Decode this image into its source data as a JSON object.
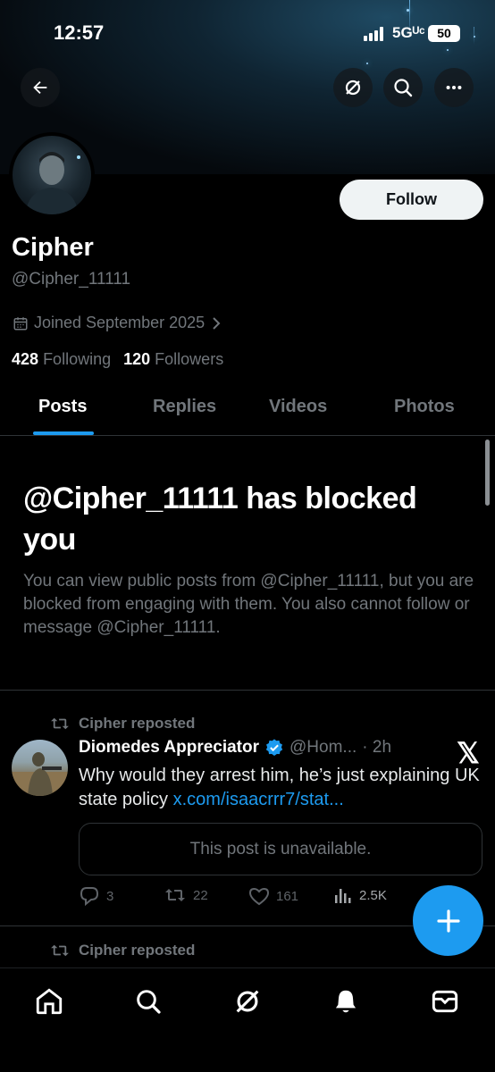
{
  "status_bar": {
    "time": "12:57",
    "network": "5Gᵁᶜ",
    "battery": "50"
  },
  "profile": {
    "name": "Cipher",
    "handle": "@Cipher_11111",
    "joined": "Joined September 2025",
    "following_count": "428",
    "following_label": "Following",
    "followers_count": "120",
    "followers_label": "Followers",
    "follow_button": "Follow"
  },
  "tabs": [
    {
      "label": "Posts",
      "active": true
    },
    {
      "label": "Replies",
      "active": false
    },
    {
      "label": "Videos",
      "active": false
    },
    {
      "label": "Photos",
      "active": false
    }
  ],
  "blocked_notice": {
    "title": "@Cipher_11111 has blocked you",
    "text": "You can view public posts from @Cipher_11111, but you are blocked from engaging with them. You also cannot follow or message @Cipher_11111."
  },
  "posts": [
    {
      "repost_label": "Cipher reposted",
      "author": "Diomedes Appreciator",
      "verified": true,
      "handle": "@Hom...",
      "time": "· 2h",
      "text": "Why would they arrest him, he’s just explaining UK state policy ",
      "link": "x.com/isaacrrr7/stat...",
      "quoted": "This post is unavailable.",
      "replies": "3",
      "reposts": "22",
      "likes": "161",
      "views": "2.5K",
      "logo": "𝕏"
    },
    {
      "repost_label": "Cipher reposted"
    }
  ],
  "colors": {
    "accent": "#1d9bf0",
    "background": "#000000",
    "muted": "#71767b",
    "divider": "#2f3336"
  },
  "icons": [
    "back-arrow-icon",
    "grok-icon",
    "search-icon",
    "more-icon",
    "calendar-icon",
    "chevron-right-icon",
    "repost-icon",
    "verified-badge-icon",
    "reply-icon",
    "like-icon",
    "views-icon",
    "plus-icon",
    "home-icon",
    "notifications-icon",
    "mail-icon"
  ]
}
